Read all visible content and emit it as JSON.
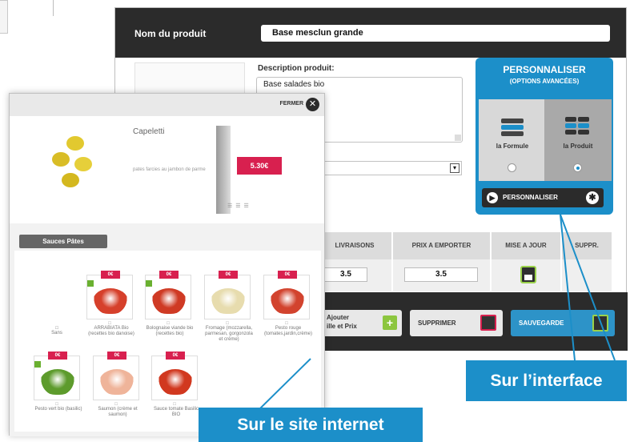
{
  "interface": {
    "product_name_label": "Nom du produit",
    "product_name_value": "Base mesclun grande",
    "description_label": "Description produit:",
    "description_value": "Base salades bio",
    "table_headers": [
      "LIVRAISONS",
      "PRIX A EMPORTER",
      "MISE A JOUR",
      "SUPPR."
    ],
    "delivery_price": "3.5",
    "takeaway_price": "3.5",
    "footer": {
      "ajouter_label_line1": "Ajouter",
      "ajouter_label_line2": "ille et Prix",
      "supprimer_label": "SUPPRIMER",
      "sauvegarder_label": "SAUVEGARDE"
    },
    "personnaliser": {
      "title": "PERSONNALISER",
      "subtitle": "(OPTIONS AVANCÉES)",
      "option_formule": "la Formule",
      "option_produit": "la Produit",
      "selected": "la Produit",
      "button_label": "PERSONNALISER"
    },
    "accent": "#1c8fc9"
  },
  "site": {
    "close_label": "FERMER",
    "product_name": "Capeletti",
    "product_description": "pates farcies au jambon de parme",
    "price": "5.30€",
    "section_tab": "Sauces Pâtes",
    "sans_label": "Sans",
    "sauces": [
      {
        "badge": "0€",
        "name": "ARRABIATA Bio (recettes bio danoise)",
        "color": "#d6402b"
      },
      {
        "badge": "0€",
        "name": "Bolognaise viande bio (recettes bio)",
        "color": "#cf3a24"
      },
      {
        "badge": "0€",
        "name": "Fromage (mozzarella, parmesan, gorgonzola et crème)",
        "color": "#e7dcae"
      },
      {
        "badge": "0€",
        "name": "Pesto rouge (tomates,jardin,crème)",
        "color": "#d2432e"
      },
      {
        "badge": "0€",
        "name": "Pesto vert bio (basilic)",
        "color": "#5d9b2c"
      },
      {
        "badge": "0€",
        "name": "Saumon (crème et saumon)",
        "color": "#efb49a"
      },
      {
        "badge": "0€",
        "name": "Sauce tomate Basilic BIO",
        "color": "#d1381f"
      }
    ],
    "accent": "#d8204f"
  },
  "callouts": {
    "site": "Sur le site internet",
    "interface": "Sur l’interface"
  }
}
